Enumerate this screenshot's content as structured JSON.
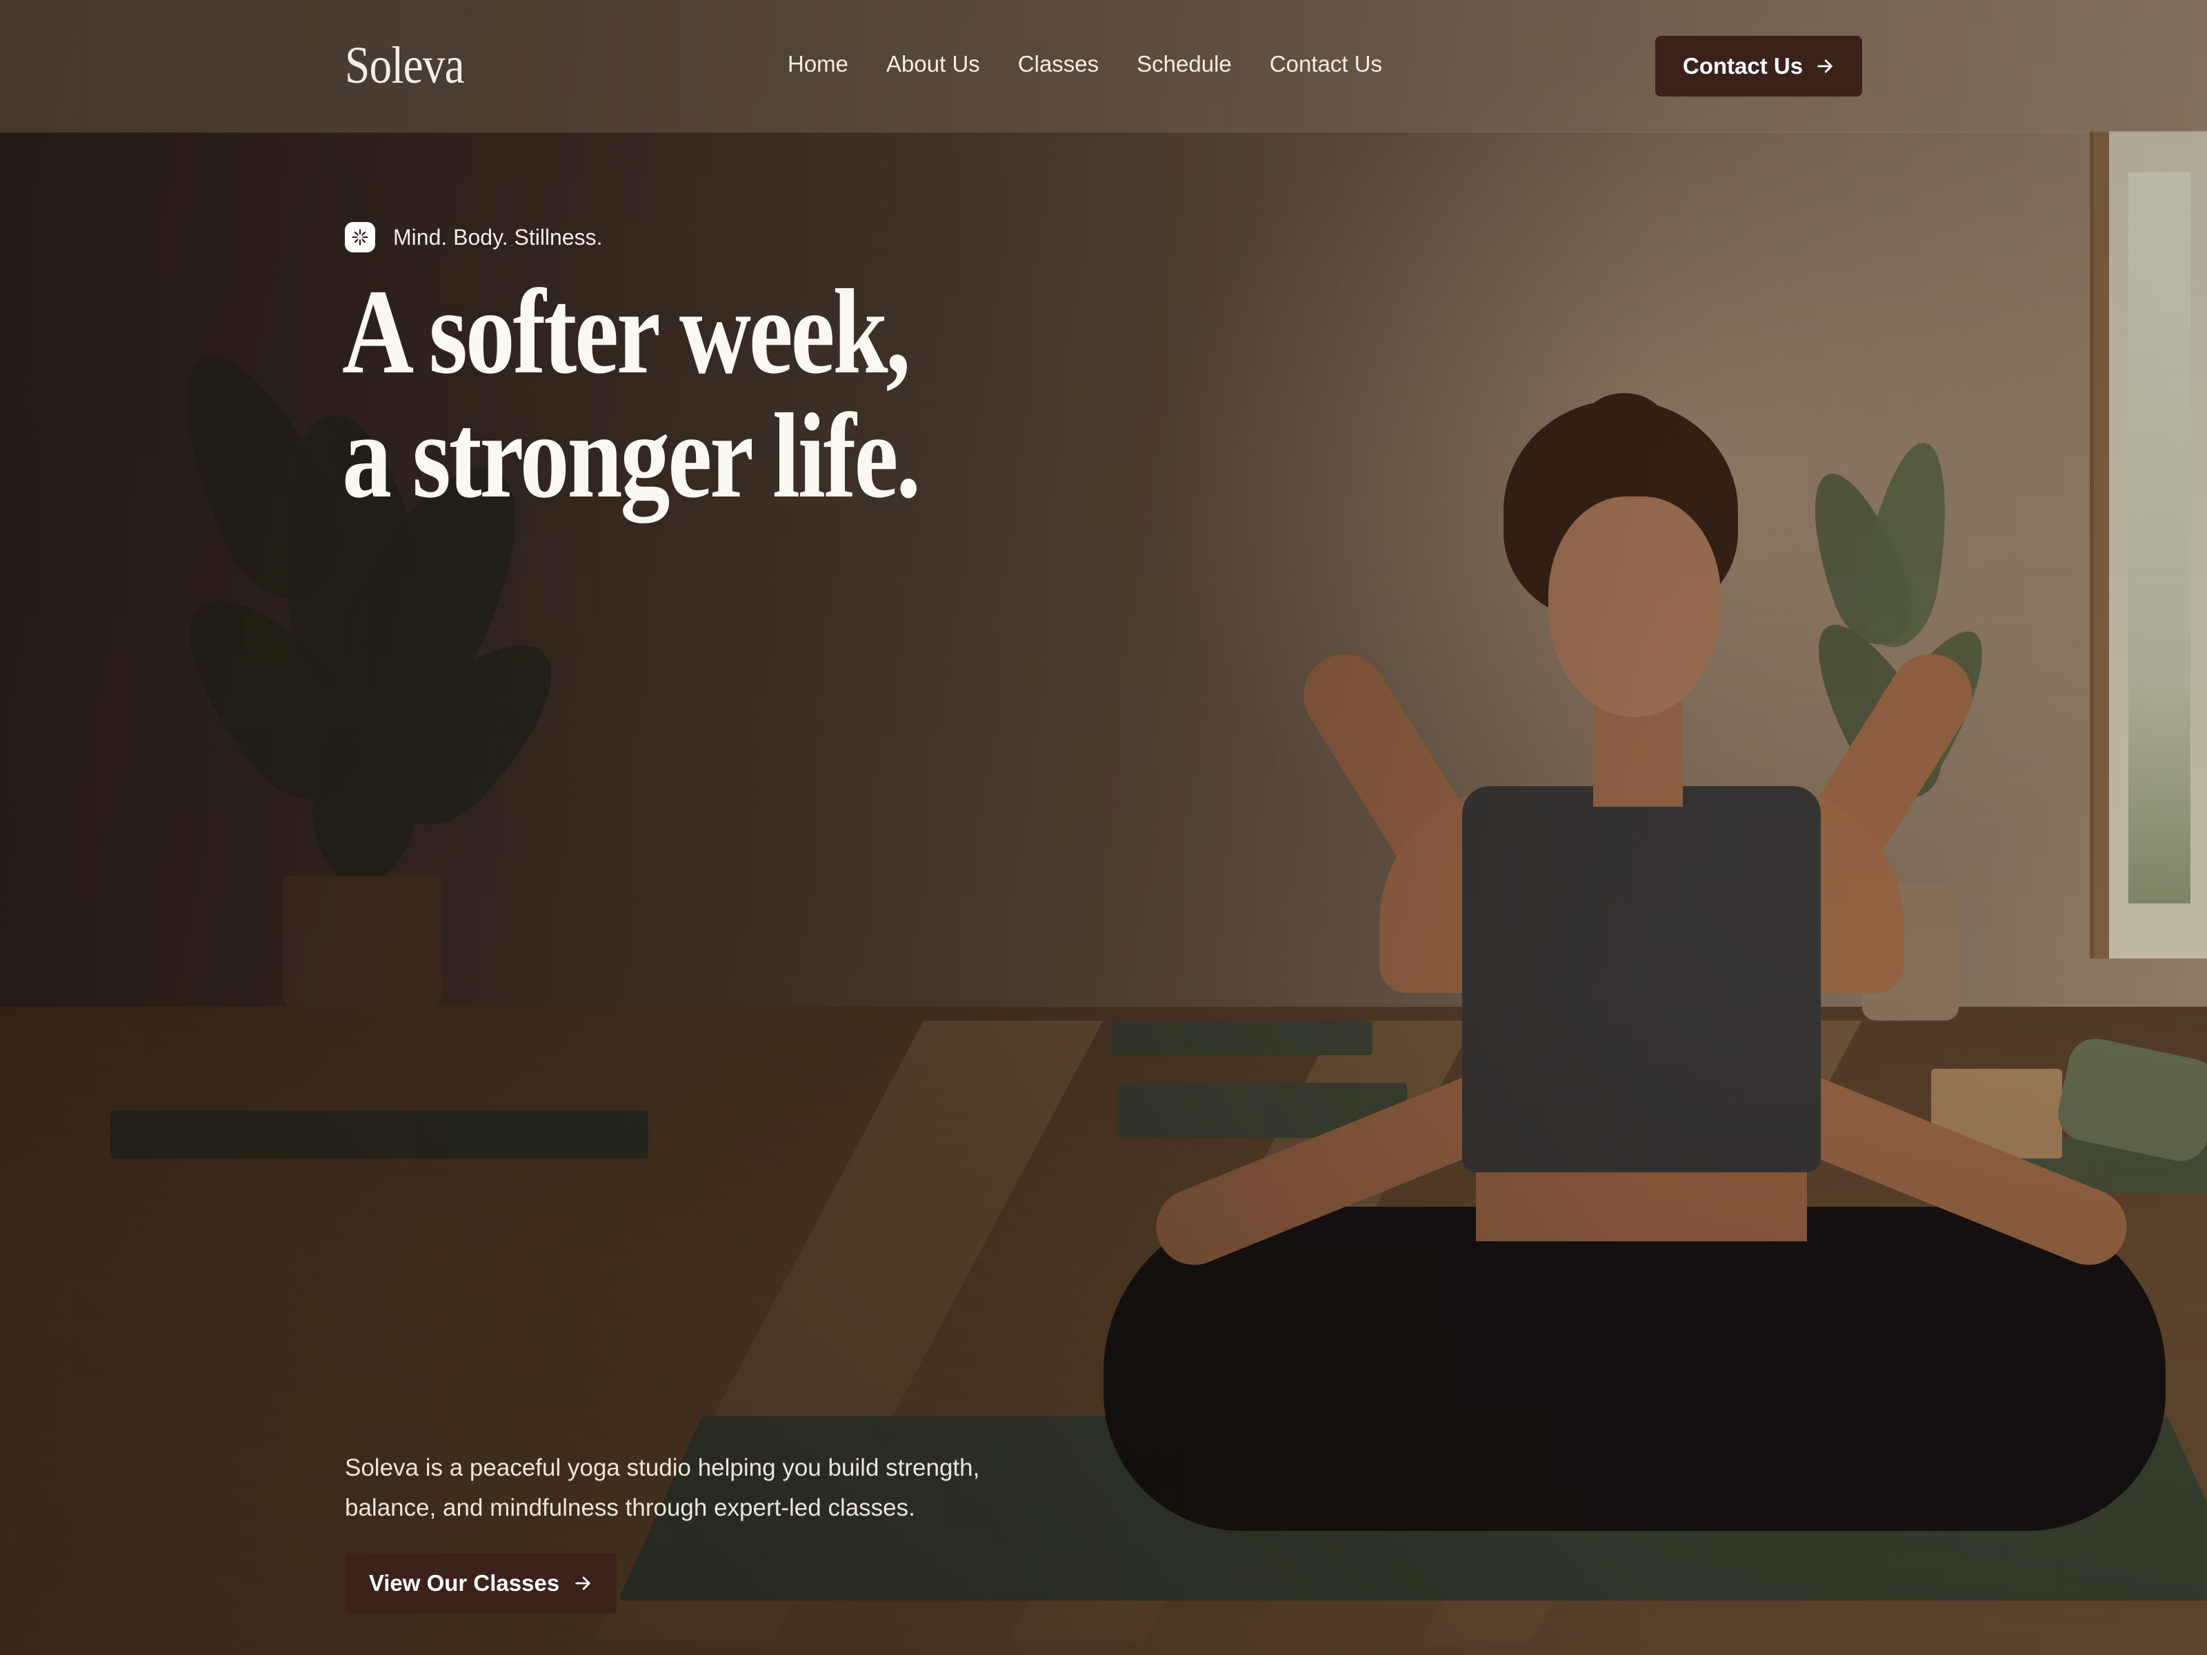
{
  "brand": {
    "logo": "Soleva"
  },
  "nav": {
    "items": [
      {
        "label": "Home"
      },
      {
        "label": "About Us"
      },
      {
        "label": "Classes"
      },
      {
        "label": "Schedule"
      },
      {
        "label": "Contact Us"
      }
    ],
    "cta_label": "Contact Us",
    "cta_icon": "arrow-right-icon"
  },
  "hero": {
    "badge_icon": "sparkle-icon",
    "badge_text": "Mind. Body. Stillness.",
    "headline_lines": [
      "A softer week,",
      "a stronger life."
    ],
    "description_lines": [
      "Soleva is a peaceful yoga studio helping you build strength,",
      "balance, and mindfulness through expert-led classes."
    ],
    "cta_label": "View Our Classes",
    "cta_icon": "arrow-right-icon",
    "image_subject": "woman meditating in lotus pose in a sunlit yoga studio"
  },
  "colors": {
    "button_bg": "#3a221b",
    "text_light": "#f3ede6",
    "header_bg": "#82705e"
  }
}
